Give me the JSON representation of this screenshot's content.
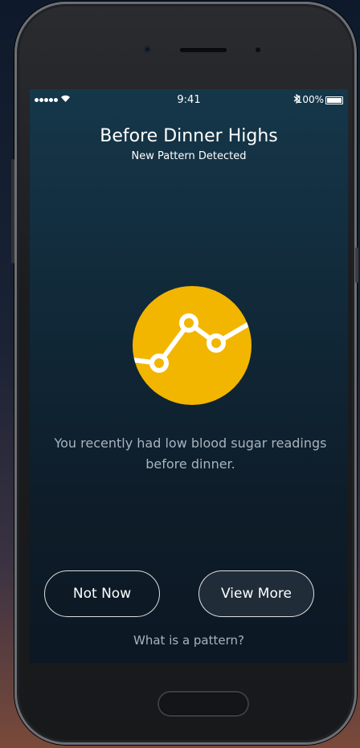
{
  "status_bar": {
    "time": "9:41",
    "battery_percent": "100%",
    "bluetooth": "✻"
  },
  "header": {
    "title": "Before Dinner Highs",
    "subtitle": "New Pattern Detected"
  },
  "pattern_icon": {
    "name": "line-chart-icon",
    "color": "#F2B600"
  },
  "message": "You recently had low blood sugar readings before dinner.",
  "buttons": {
    "not_now": "Not Now",
    "view_more": "View More"
  },
  "help_link": "What is a pattern?",
  "colors": {
    "accent": "#F2B600",
    "screen_bg": "#112a3a",
    "muted_text": "#a8b3bd"
  }
}
